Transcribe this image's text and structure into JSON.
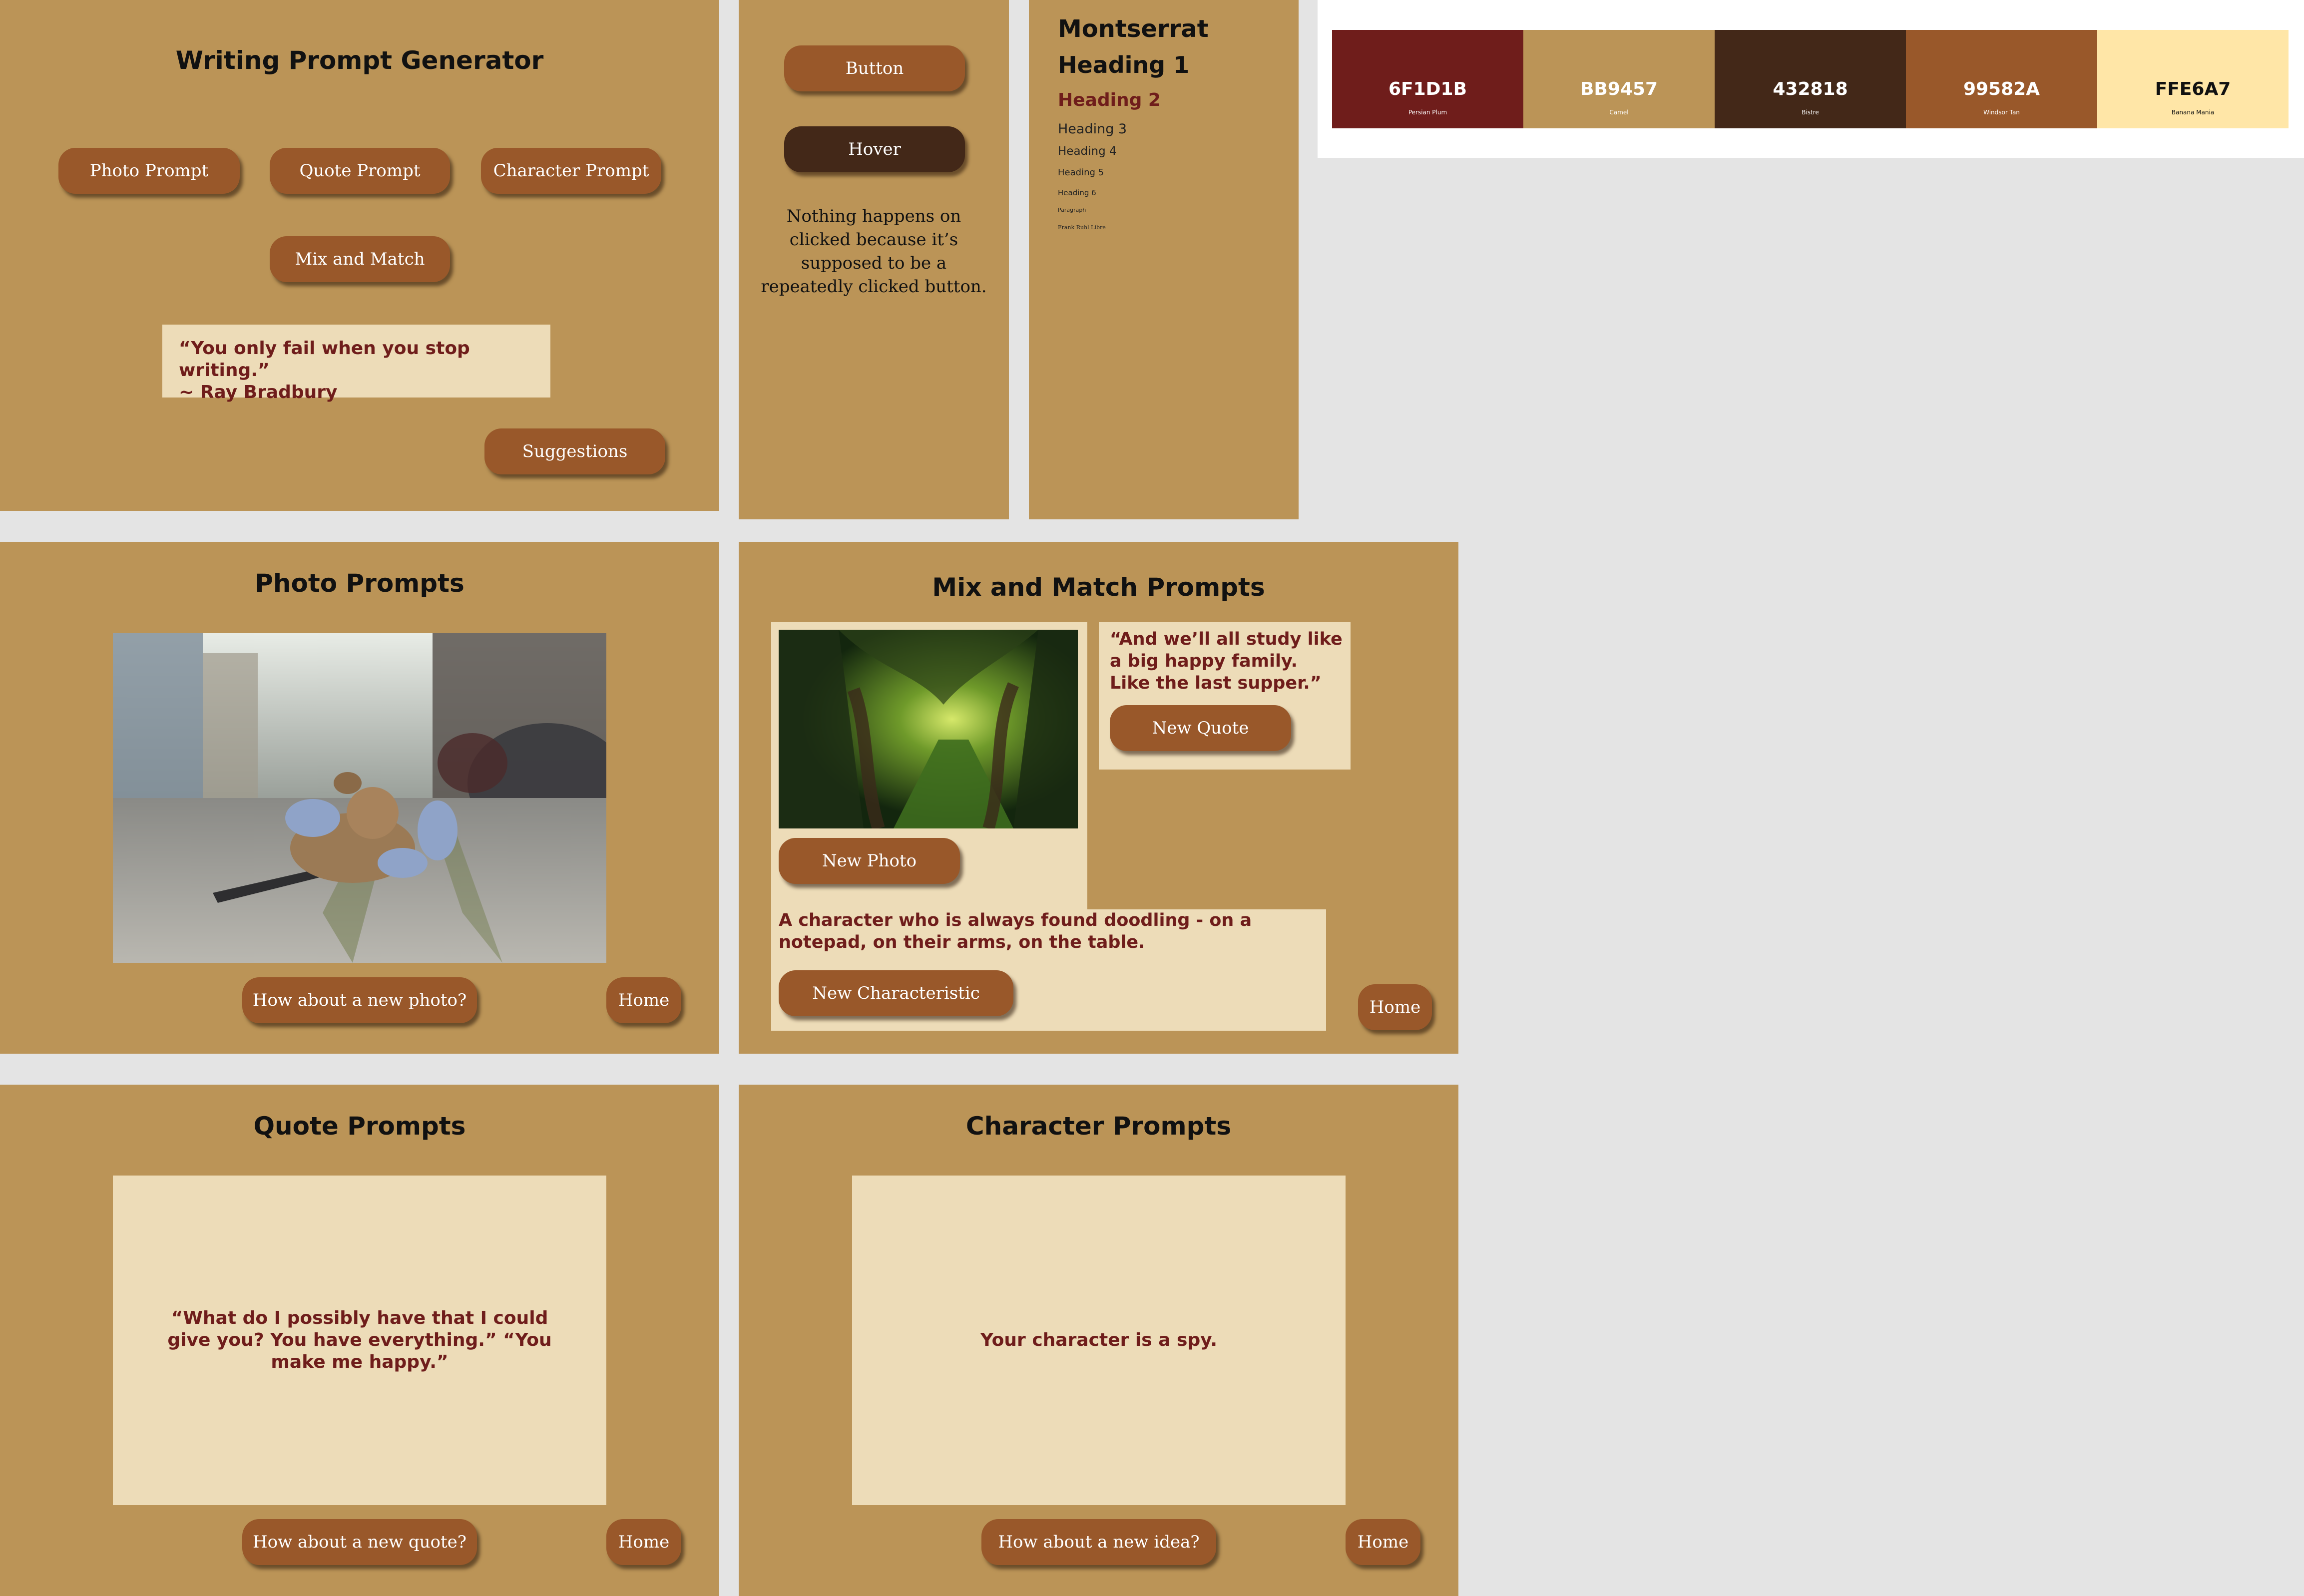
{
  "home": {
    "title": "Writing Prompt Generator",
    "buttons": {
      "photo": "Photo Prompt",
      "quote": "Quote Prompt",
      "character": "Character Prompt",
      "mix": "Mix and Match",
      "suggestions": "Suggestions"
    },
    "quote_line1": "“You only fail when you stop writing.”",
    "quote_line2": "~ Ray Bradbury"
  },
  "button_states": {
    "normal": "Button",
    "hover": "Hover",
    "note": "Nothing happens on clicked because it’s supposed to be a repeatedly clicked button."
  },
  "typography": {
    "font_name": "Montserrat",
    "h1": "Heading 1",
    "h2": "Heading 2",
    "h3": "Heading 3",
    "h4": "Heading 4",
    "h5": "Heading 5",
    "h6": "Heading 6",
    "paragraph": "Paragraph",
    "font2": "Frank Ruhl Libre"
  },
  "palette": [
    {
      "hex": "6F1D1B",
      "name": "Persian Plum",
      "color": "#6F1D1B",
      "text_color": "#ffffff"
    },
    {
      "hex": "BB9457",
      "name": "Camel",
      "color": "#BB9457",
      "text_color": "#ffffff"
    },
    {
      "hex": "432818",
      "name": "Bistre",
      "color": "#432818",
      "text_color": "#ffffff"
    },
    {
      "hex": "99582A",
      "name": "Windsor Tan",
      "color": "#99582A",
      "text_color": "#ffffff"
    },
    {
      "hex": "FFE6A7",
      "name": "Banana Mania",
      "color": "#FFE6A7",
      "text_color": "#111111"
    }
  ],
  "photo_page": {
    "title": "Photo Prompts",
    "new_button": "How about a new photo?",
    "home_button": "Home"
  },
  "mix_page": {
    "title": "Mix and Match Prompts",
    "quote": "“And we’ll all study like a big happy family. Like the last supper.”",
    "new_quote": "New Quote",
    "new_photo": "New Photo",
    "character": "A character who is always found doodling - on a notepad, on their arms, on the table.",
    "new_characteristic": "New Characteristic",
    "home_button": "Home"
  },
  "quote_page": {
    "title": "Quote Prompts",
    "quote": "“What do I possibly have that I could give you? You have everything.” “You make me happy.”",
    "new_button": "How about a new quote?",
    "home_button": "Home"
  },
  "character_page": {
    "title": "Character Prompts",
    "text": "Your character is a spy.",
    "new_button": "How about a new idea?",
    "home_button": "Home"
  },
  "colors": {
    "background": "#e4e4e4",
    "frame": "#BB9457",
    "button": "#99582A",
    "button_hover": "#432818",
    "panel": "#EDDCB8",
    "prompt_text": "#6F1D1B"
  }
}
